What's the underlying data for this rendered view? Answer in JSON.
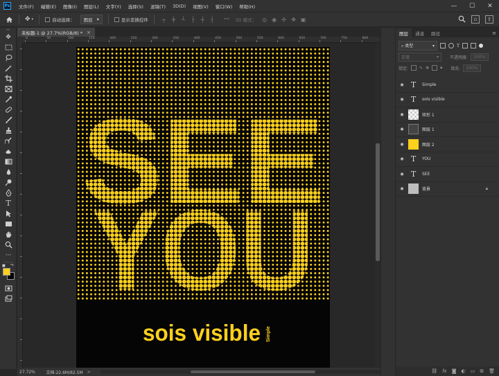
{
  "app": {
    "logo": "Ps"
  },
  "menu": {
    "items": [
      "文件(F)",
      "编辑(E)",
      "图像(I)",
      "图层(L)",
      "文字(Y)",
      "选择(S)",
      "滤镜(T)",
      "3D(D)",
      "视图(V)",
      "窗口(W)",
      "帮助(H)"
    ]
  },
  "options": {
    "auto_select_label": "自动选择：",
    "auto_select_target": "图层",
    "show_transform_label": "显示变换控件",
    "mode_3d_label": "3D 模式："
  },
  "document": {
    "tab_title": "未标题-1 @ 27.7%(RGB/8) *",
    "close_glyph": "×",
    "ruler_labels": [
      "0",
      "50",
      "100",
      "150",
      "200",
      "250",
      "300",
      "350",
      "400",
      "450",
      "500",
      "550",
      "600",
      "650",
      "700",
      "750",
      "800"
    ]
  },
  "artwork": {
    "background_color": "#050505",
    "dot_color": "#fcd01d",
    "hidden_words": [
      "SEE",
      "YOU"
    ],
    "headline": "sois visible",
    "side_text": "Simple"
  },
  "status": {
    "zoom": "27.72%",
    "doc_info": "文档:22.6M/82.5M",
    "arrow": ">"
  },
  "layers_panel": {
    "tabs": [
      "图层",
      "通道",
      "路径"
    ],
    "filter_kind": "类型",
    "blend_mode": "正常",
    "opacity_label": "不透明度:",
    "opacity_value": "100%",
    "lock_label": "锁定:",
    "fill_label": "填充:",
    "fill_value": "100%",
    "layers": [
      {
        "name": "Simple",
        "thumb": "T",
        "kind": "text"
      },
      {
        "name": "sois visible",
        "thumb": "T",
        "kind": "text"
      },
      {
        "name": "矩形 1",
        "thumb": "",
        "kind": "checker"
      },
      {
        "name": "图层 1",
        "thumb": "",
        "kind": "grid"
      },
      {
        "name": "图层 2",
        "thumb": "",
        "kind": "yellow"
      },
      {
        "name": "YOU",
        "thumb": "T",
        "kind": "text"
      },
      {
        "name": "SEE",
        "thumb": "T",
        "kind": "text"
      },
      {
        "name": "背景",
        "thumb": "",
        "kind": "gray",
        "locked": true
      }
    ]
  }
}
